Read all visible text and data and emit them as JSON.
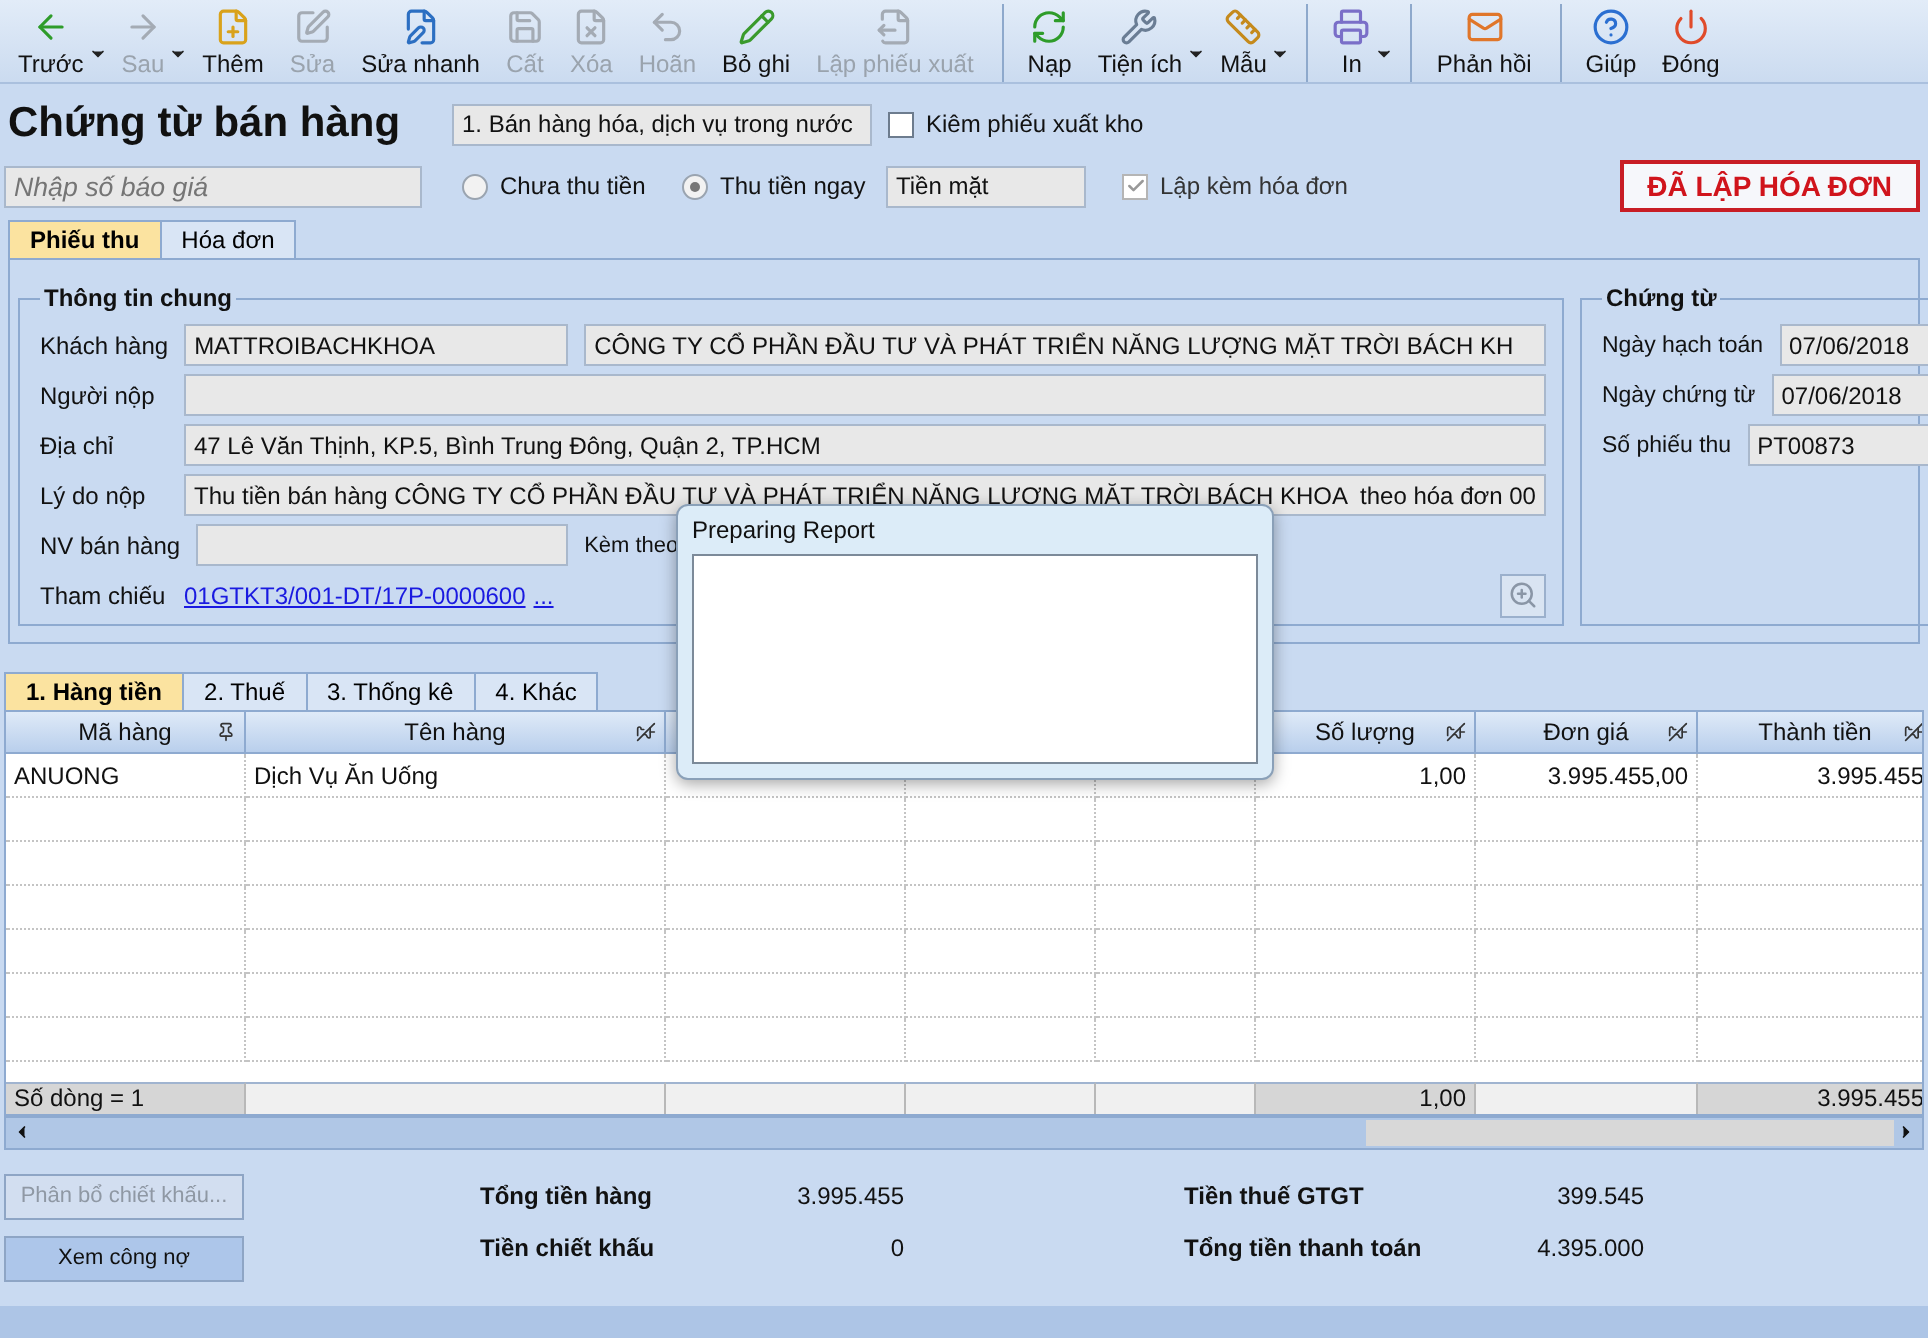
{
  "toolbar": [
    {
      "label": "Trước",
      "disabled": false,
      "dropdown": true,
      "separator_before": false
    },
    {
      "label": "Sau",
      "disabled": true,
      "dropdown": true,
      "separator_before": false
    },
    {
      "label": "Thêm",
      "disabled": false,
      "dropdown": false,
      "separator_before": false
    },
    {
      "label": "Sửa",
      "disabled": true,
      "dropdown": false,
      "separator_before": false
    },
    {
      "label": "Sửa nhanh",
      "disabled": false,
      "dropdown": false,
      "separator_before": false
    },
    {
      "label": "Cất",
      "disabled": true,
      "dropdown": false,
      "separator_before": false
    },
    {
      "label": "Xóa",
      "disabled": true,
      "dropdown": false,
      "separator_before": false
    },
    {
      "label": "Hoãn",
      "disabled": true,
      "dropdown": false,
      "separator_before": false
    },
    {
      "label": "Bỏ ghi",
      "disabled": false,
      "dropdown": false,
      "separator_before": false
    },
    {
      "label": "Lập phiếu xuất",
      "disabled": true,
      "dropdown": false,
      "separator_before": false
    },
    {
      "label": "Nạp",
      "disabled": false,
      "dropdown": false,
      "separator_before": true
    },
    {
      "label": "Tiện ích",
      "disabled": false,
      "dropdown": true,
      "separator_before": false
    },
    {
      "label": "Mẫu",
      "disabled": false,
      "dropdown": true,
      "separator_before": false
    },
    {
      "label": "In",
      "disabled": false,
      "dropdown": true,
      "separator_before": true
    },
    {
      "label": "Phản hồi",
      "disabled": false,
      "dropdown": false,
      "separator_before": true
    },
    {
      "label": "Giúp",
      "disabled": false,
      "dropdown": false,
      "separator_before": true
    },
    {
      "label": "Đóng",
      "disabled": false,
      "dropdown": false,
      "separator_before": false
    }
  ],
  "title": "Chứng từ bán hàng",
  "voucher_type": "1. Bán hàng hóa, dịch vụ trong nước",
  "export_checkbox": {
    "label": "Kiêm phiếu xuất kho",
    "checked": false,
    "disabled": false
  },
  "quote_field": {
    "placeholder": "Nhập số báo giá"
  },
  "payment_options": [
    {
      "label": "Chưa thu tiền",
      "selected": false
    },
    {
      "label": "Thu tiền ngay",
      "selected": true
    }
  ],
  "payment_method": "Tiền mặt",
  "invoice_checkbox": {
    "label": "Lập kèm hóa đơn",
    "checked": true,
    "disabled": true
  },
  "status_badge": "ĐÃ LẬP HÓA ĐƠN",
  "tabs": [
    {
      "label": "Phiếu thu",
      "selected": true
    },
    {
      "label": "Hóa đơn",
      "selected": false
    }
  ],
  "general_info": {
    "title": "Thông tin chung",
    "customer_label": "Khách hàng",
    "customer_code": "MATTROIBACHKHOA",
    "customer_name": "CÔNG TY CỔ PHẦN ĐẦU TƯ VÀ PHÁT TRIỂN NĂNG LƯỢNG MẶT TRỜI BÁCH KH",
    "payer_label": "Người nộp",
    "address_label": "Địa chỉ",
    "address": "47 Lê Văn Thịnh, KP.5, Bình Trung Đông, Quận 2, TP.HCM",
    "reason_label": "Lý do nộp",
    "reason": "Thu tiền bán hàng CÔNG TY CỔ PHẦN ĐẦU TƯ VÀ PHÁT TRIỂN NĂNG LƯỢNG MẶT TRỜI BÁCH KHOA  theo hóa đơn 00",
    "salesperson_label": "NV bán hàng",
    "attached_label": "Kèm theo",
    "reference_label": "Tham chiếu",
    "reference_link": "01GTKT3/001-DT/17P-0000600",
    "reference_more": "..."
  },
  "voucher": {
    "title": "Chứng từ",
    "fields": [
      {
        "label": "Ngày hạch toán",
        "value": "07/06/2018"
      },
      {
        "label": "Ngày chứng từ",
        "value": "07/06/2018"
      },
      {
        "label": "Số phiếu thu",
        "value": "PT00873"
      }
    ]
  },
  "grid_tabs": [
    {
      "label": "1. Hàng tiền",
      "selected": true
    },
    {
      "label": "2. Thuế",
      "selected": false
    },
    {
      "label": "3. Thống kê",
      "selected": false
    },
    {
      "label": "4. Khác",
      "selected": false
    }
  ],
  "table": {
    "columns": [
      {
        "label": "Mã hàng",
        "pinned": true
      },
      {
        "label": "Tên hàng",
        "pinned": false
      },
      {
        "label": "Số lượng",
        "pinned": false
      },
      {
        "label": "Đơn giá",
        "pinned": false
      },
      {
        "label": "Thành tiền",
        "pinned": false
      }
    ],
    "rows": [
      {
        "ma_hang": "ANUONG",
        "ten_hang": "Dịch Vụ Ăn Uống",
        "so_luong": "1,00",
        "don_gia": "3.995.455,00",
        "thanh_tien": "3.995.455"
      }
    ],
    "footer": {
      "row_count": "Số dòng = 1",
      "so_luong": "1,00",
      "thanh_tien": "3.995.455"
    }
  },
  "buttons": [
    {
      "label": "Phân bổ chiết khấu...",
      "disabled": true
    },
    {
      "label": "Xem công nợ",
      "disabled": false
    }
  ],
  "totals": [
    {
      "label": "Tổng tiền hàng",
      "value": "3.995.455"
    },
    {
      "label": "Tiền chiết khấu",
      "value": "0"
    },
    {
      "label": "Tiền thuế GTGT",
      "value": "399.545"
    },
    {
      "label": "Tổng tiền thanh toán",
      "value": "4.395.000"
    }
  ],
  "dialog": {
    "title": "Preparing Report"
  }
}
